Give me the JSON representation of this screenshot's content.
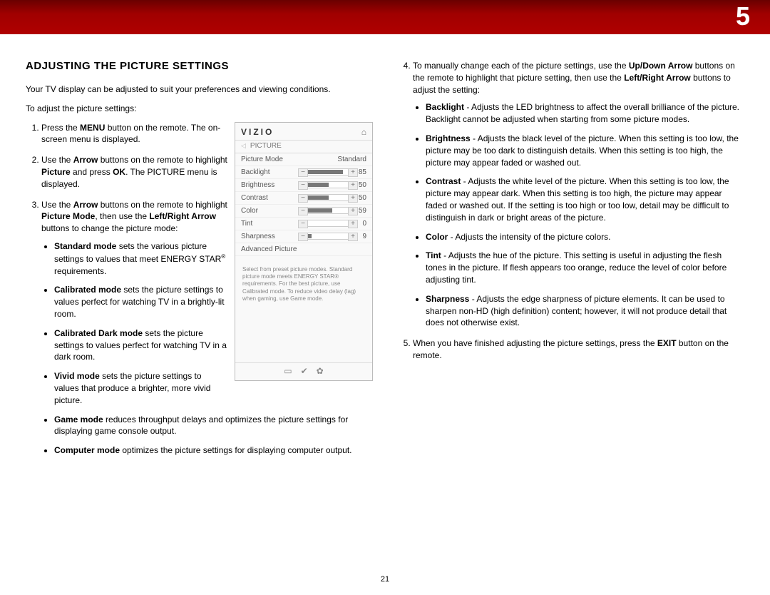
{
  "chapter_number": "5",
  "page_number": "21",
  "heading": "ADJUSTING THE PICTURE SETTINGS",
  "intro": "Your TV display can be adjusted to suit your preferences and viewing conditions.",
  "lead": "To adjust the picture settings:",
  "steps": {
    "s1": {
      "pre": "Press the ",
      "b1": "MENU",
      "post": " button on the remote. The on-screen menu is displayed."
    },
    "s2": {
      "pre": "Use the ",
      "b1": "Arrow",
      "mid1": " buttons on the remote to highlight ",
      "b2": "Picture",
      "mid2": " and press ",
      "b3": "OK",
      "post": ". The PICTURE menu is displayed."
    },
    "s3": {
      "pre": "Use the ",
      "b1": "Arrow",
      "mid1": " buttons on the remote to highlight ",
      "b2": "Picture Mode",
      "mid2": ", then use the ",
      "b3": "Left/Right Arrow",
      "post": " buttons to change the picture mode:"
    },
    "s4": {
      "pre": "To manually change each of the picture settings, use the ",
      "b1": "Up/Down Arrow",
      "mid1": " buttons on the remote to highlight that picture setting, then use the ",
      "b2": "Left/Right Arrow",
      "post": " buttons to adjust the setting:"
    },
    "s5": {
      "pre": "When you have finished adjusting the picture settings, press the ",
      "b1": "EXIT",
      "post": " button on the remote."
    }
  },
  "modes": {
    "standard": {
      "b": "Standard mode",
      "t": " sets the various picture settings to values that meet ENERGY STAR",
      "sup": "®",
      "t2": " requirements."
    },
    "calibrated": {
      "b": "Calibrated mode",
      "t": " sets the picture settings to values perfect for watching TV in a brightly-lit room."
    },
    "calibrated_dark": {
      "b": "Calibrated Dark mode",
      "t": " sets the picture settings to values perfect for watching TV in a dark room."
    },
    "vivid": {
      "b": "Vivid mode",
      "t": " sets the picture settings to values that produce a brighter, more vivid picture."
    },
    "game": {
      "b": "Game mode",
      "t": " reduces throughput delays and optimizes the picture settings for displaying game console output."
    },
    "computer": {
      "b": "Computer mode",
      "t": " optimizes the picture settings for displaying computer output."
    }
  },
  "settings_desc": {
    "backlight": {
      "b": "Backlight",
      "t": " - Adjusts the LED brightness to affect the overall brilliance of the picture. Backlight cannot be adjusted when starting from some picture modes."
    },
    "brightness": {
      "b": "Brightness",
      "t": " - Adjusts the black level of the picture. When this setting is too low, the picture may be too dark to distinguish details. When this setting is too high, the picture may appear faded or washed out."
    },
    "contrast": {
      "b": "Contrast",
      "t": " - Adjusts the white level of the picture. When this setting is too low, the picture may appear dark. When this setting is too high, the picture may appear faded or washed out. If the setting is too high or too low, detail may be difficult to distinguish in dark or bright areas of the picture."
    },
    "color": {
      "b": "Color",
      "t": " - Adjusts the intensity of the picture colors."
    },
    "tint": {
      "b": "Tint",
      "t": " - Adjusts the hue of the picture. This setting is useful in adjusting the flesh tones in the picture. If flesh appears too orange, reduce the level of color before adjusting tint."
    },
    "sharpness": {
      "b": "Sharpness",
      "t": " - Adjusts the edge sharpness of picture elements. It can be used to sharpen non-HD (high definition) content; however, it will not produce detail that does not otherwise exist."
    }
  },
  "osd": {
    "brand": "VIZIO",
    "crumb": "PICTURE",
    "mode_label": "Picture Mode",
    "mode_value": "Standard",
    "rows": {
      "backlight": {
        "label": "Backlight",
        "value": "85",
        "pct": 85
      },
      "brightness": {
        "label": "Brightness",
        "value": "50",
        "pct": 50
      },
      "contrast": {
        "label": "Contrast",
        "value": "50",
        "pct": 50
      },
      "color": {
        "label": "Color",
        "value": "59",
        "pct": 59
      },
      "tint": {
        "label": "Tint",
        "value": "0",
        "pct": 0
      },
      "sharpness": {
        "label": "Sharpness",
        "value": "9",
        "pct": 9
      }
    },
    "advanced": "Advanced Picture",
    "hint": "Select from preset picture modes. Standard picture mode meets ENERGY STAR® requirements. For the best picture, use Calibrated mode. To reduce video delay (lag) when gaming, use Game mode."
  }
}
